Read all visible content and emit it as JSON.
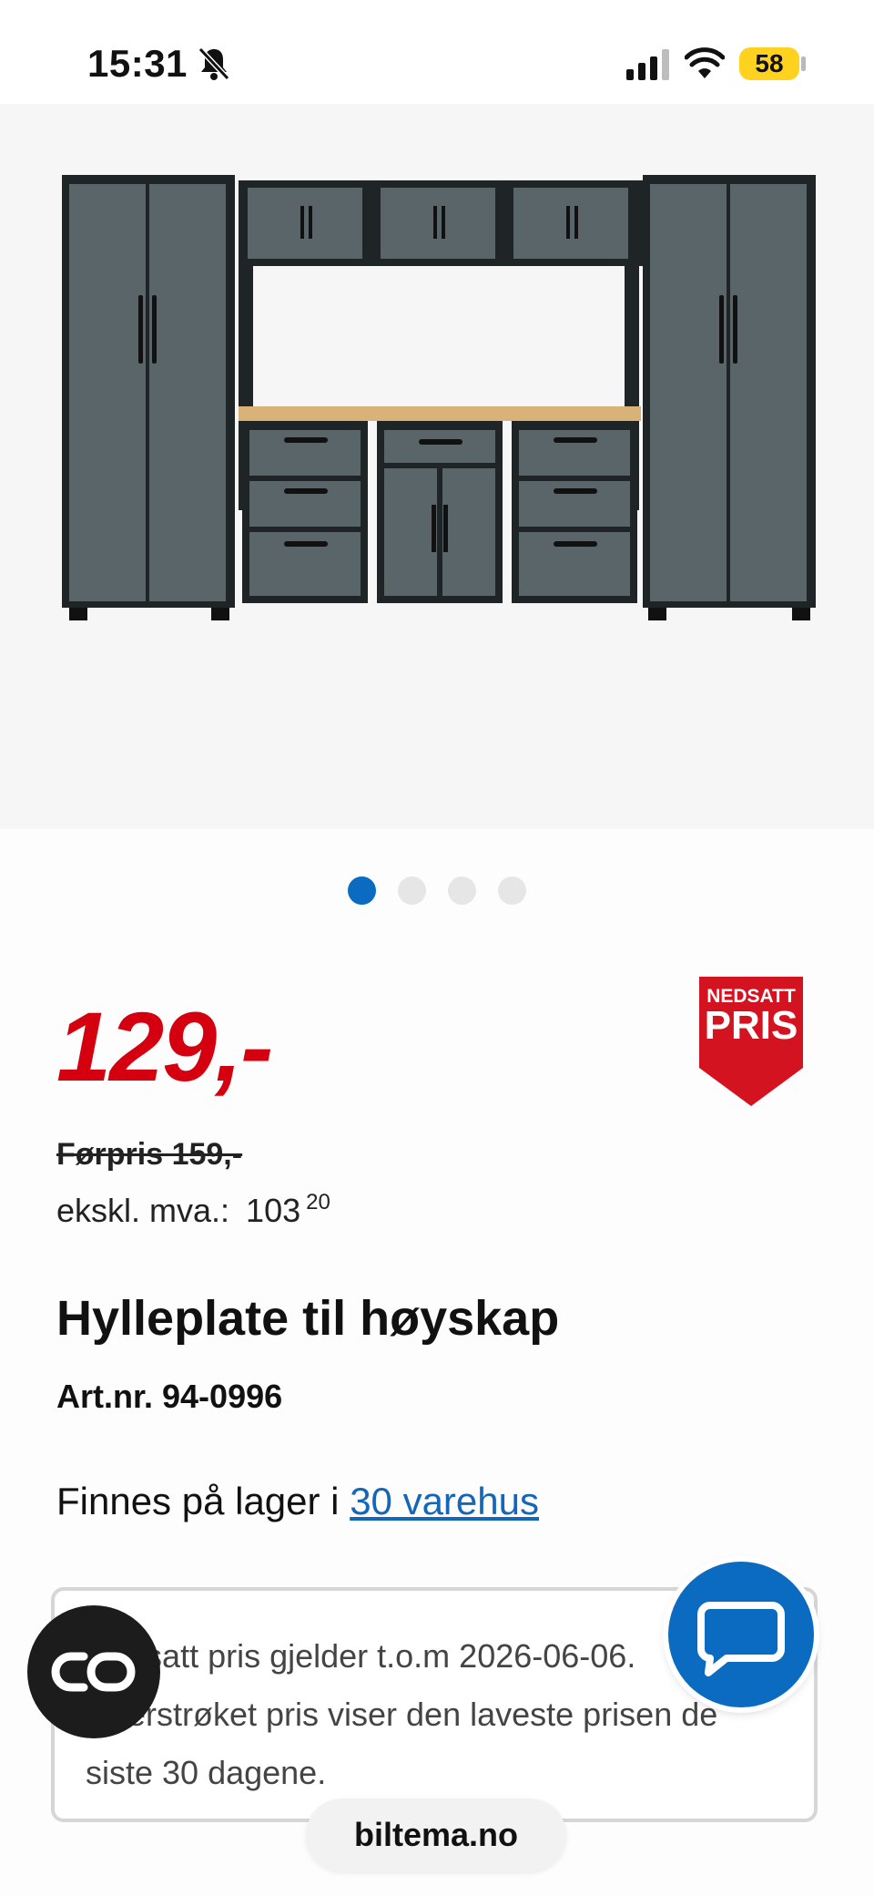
{
  "status": {
    "time": "15:31",
    "battery": "58"
  },
  "gallery": {
    "slides": 4,
    "active_index": 0
  },
  "product": {
    "price": "129,-",
    "badge_line1": "NEDSATT",
    "badge_line2": "PRIS",
    "old_price": "Førpris 159,-",
    "ex_vat_label": "ekskl. mva.:",
    "ex_vat_amount": "103",
    "ex_vat_decimals": "20",
    "title": "Hylleplate til høyskap",
    "art_nr": "Art.nr. 94-0996",
    "stock_prefix": "Finnes på lager i",
    "stock_link": "30 varehus"
  },
  "notice": {
    "line1": "Nedsatt pris gjelder t.o.m 2026-06-06.",
    "line2": "Overstrøket pris viser den laveste prisen de",
    "line3": "siste 30 dagene."
  },
  "browser": {
    "url": "biltema.no"
  },
  "colors": {
    "price_red": "#d4000f",
    "accent_blue": "#0b6bc0",
    "link_blue": "#1466b8"
  },
  "icons": [
    "bell-slash-icon",
    "signal-icon",
    "wifi-icon",
    "battery-icon",
    "co-icon",
    "chat-icon"
  ]
}
